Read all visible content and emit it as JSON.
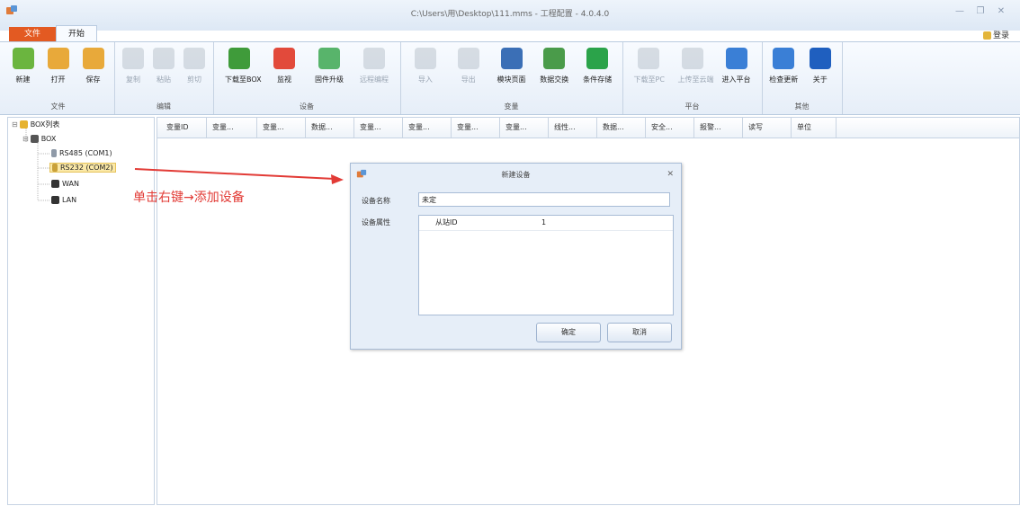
{
  "window": {
    "title": "C:\\Users\\用\\Desktop\\111.mms - 工程配置 - 4.0.4.0"
  },
  "tabs": {
    "file": "文件",
    "start": "开始"
  },
  "login": "登录",
  "ribbon": {
    "groups": [
      {
        "label": "文件",
        "buttons": [
          {
            "label": "新建",
            "icon": "new-icon",
            "color": "#6bb53f",
            "enabled": true
          },
          {
            "label": "打开",
            "icon": "open-icon",
            "color": "#e8a93a",
            "enabled": true
          },
          {
            "label": "保存",
            "icon": "save-icon",
            "color": "#e8a93a",
            "enabled": true
          }
        ]
      },
      {
        "label": "编辑",
        "buttons": [
          {
            "label": "复制",
            "icon": "copy-icon",
            "color": "#9aa5b3",
            "enabled": false
          },
          {
            "label": "粘贴",
            "icon": "paste-icon",
            "color": "#9aa5b3",
            "enabled": false
          },
          {
            "label": "剪切",
            "icon": "cut-icon",
            "color": "#9aa5b3",
            "enabled": false
          }
        ]
      },
      {
        "label": "设备",
        "buttons": [
          {
            "label": "下载至BOX",
            "icon": "download-icon",
            "color": "#3f9b3a",
            "enabled": true
          },
          {
            "label": "监视",
            "icon": "monitor-icon",
            "color": "#e24a3b",
            "enabled": true
          },
          {
            "label": "固件升级",
            "icon": "firmware-icon",
            "color": "#58b46b",
            "enabled": true
          },
          {
            "label": "远程编程",
            "icon": "remote-program-icon",
            "color": "#9aa5b3",
            "enabled": false
          }
        ]
      },
      {
        "label": "变量",
        "buttons": [
          {
            "label": "导入",
            "icon": "import-icon",
            "color": "#9aa5b3",
            "enabled": false
          },
          {
            "label": "导出",
            "icon": "export-icon",
            "color": "#9aa5b3",
            "enabled": false
          },
          {
            "label": "模块页面",
            "icon": "module-page-icon",
            "color": "#3b6fb6",
            "enabled": true
          },
          {
            "label": "数据交换",
            "icon": "data-exchange-icon",
            "color": "#4a9b4a",
            "enabled": true
          },
          {
            "label": "条件存储",
            "icon": "conditional-storage-icon",
            "color": "#2ba34a",
            "enabled": true
          }
        ]
      },
      {
        "label": "平台",
        "buttons": [
          {
            "label": "下载至PC",
            "icon": "download-pc-icon",
            "color": "#9aa5b3",
            "enabled": false
          },
          {
            "label": "上传至云端",
            "icon": "upload-cloud-icon",
            "color": "#9aa5b3",
            "enabled": false
          },
          {
            "label": "进入平台",
            "icon": "enter-platform-icon",
            "color": "#3a7fd6",
            "enabled": true
          }
        ]
      },
      {
        "label": "其他",
        "buttons": [
          {
            "label": "检查更新",
            "icon": "check-update-icon",
            "color": "#3a7fd6",
            "enabled": true
          },
          {
            "label": "关于",
            "icon": "about-icon",
            "color": "#1f5fbf",
            "enabled": true
          }
        ]
      }
    ]
  },
  "tree": {
    "root": "BOX列表",
    "box": "BOX",
    "items": [
      "RS485 (COM1)",
      "RS232 (COM2)",
      "WAN",
      "LAN"
    ],
    "selected_index": 1
  },
  "grid": {
    "columns": [
      "变量ID",
      "变量...",
      "变量...",
      "数据...",
      "变量...",
      "变量...",
      "变量...",
      "变量...",
      "线性...",
      "数据...",
      "安全...",
      "报警...",
      "读写",
      "单位"
    ]
  },
  "annotation": "单击右键→添加设备",
  "dialog": {
    "title": "新建设备",
    "name_label": "设备名称",
    "name_value": "未定",
    "props_label": "设备属性",
    "prop_key": "从站ID",
    "prop_value": "1",
    "ok": "确定",
    "cancel": "取消"
  }
}
